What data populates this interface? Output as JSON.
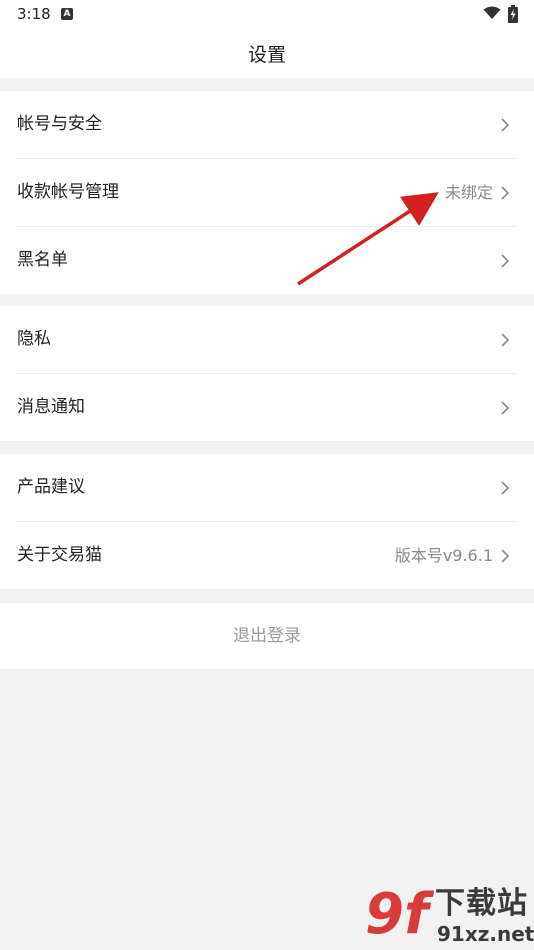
{
  "status_bar": {
    "time": "3:18",
    "notification_glyph": "A",
    "icons": [
      "wifi-icon",
      "battery-charging-icon"
    ]
  },
  "header": {
    "title": "设置"
  },
  "groups": [
    {
      "items": [
        {
          "label": "帐号与安全",
          "value": ""
        },
        {
          "label": "收款帐号管理",
          "value": "未绑定"
        },
        {
          "label": "黑名单",
          "value": ""
        }
      ]
    },
    {
      "items": [
        {
          "label": "隐私",
          "value": ""
        },
        {
          "label": "消息通知",
          "value": ""
        }
      ]
    },
    {
      "items": [
        {
          "label": "产品建议",
          "value": ""
        },
        {
          "label": "关于交易猫",
          "value": "版本号v9.6.1"
        }
      ]
    }
  ],
  "logout": {
    "label": "退出登录"
  },
  "annotation": {
    "color": "#d42020",
    "points_to": "未绑定"
  },
  "watermark": {
    "mark": "9f",
    "title": "下载站",
    "url": "91xz.net",
    "color": "#d93b3b"
  }
}
